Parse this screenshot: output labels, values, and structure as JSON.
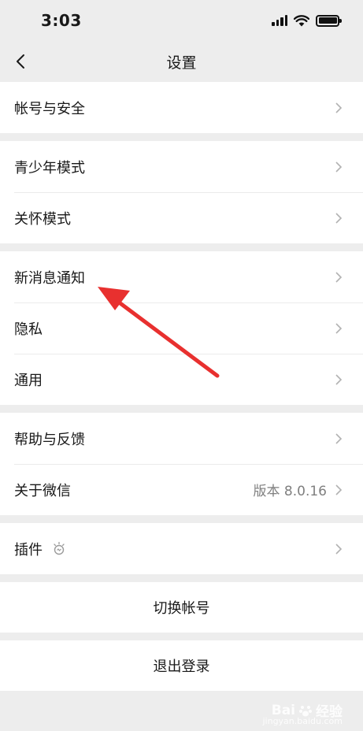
{
  "status_bar": {
    "time": "3:03"
  },
  "nav": {
    "title": "设置"
  },
  "groups": [
    {
      "items": [
        {
          "label": "帐号与安全"
        }
      ]
    },
    {
      "items": [
        {
          "label": "青少年模式"
        },
        {
          "label": "关怀模式"
        }
      ]
    },
    {
      "items": [
        {
          "label": "新消息通知"
        },
        {
          "label": "隐私"
        },
        {
          "label": "通用"
        }
      ]
    },
    {
      "items": [
        {
          "label": "帮助与反馈"
        },
        {
          "label": "关于微信",
          "value": "版本 8.0.16"
        }
      ]
    },
    {
      "items": [
        {
          "label": "插件"
        }
      ]
    }
  ],
  "actions": {
    "switch_account": "切换帐号",
    "logout": "退出登录"
  },
  "annotation": {
    "color": "#e8302f"
  },
  "watermark": {
    "text": "Bai",
    "text_after": "经验",
    "sub": "jingyan.baidu.com"
  }
}
